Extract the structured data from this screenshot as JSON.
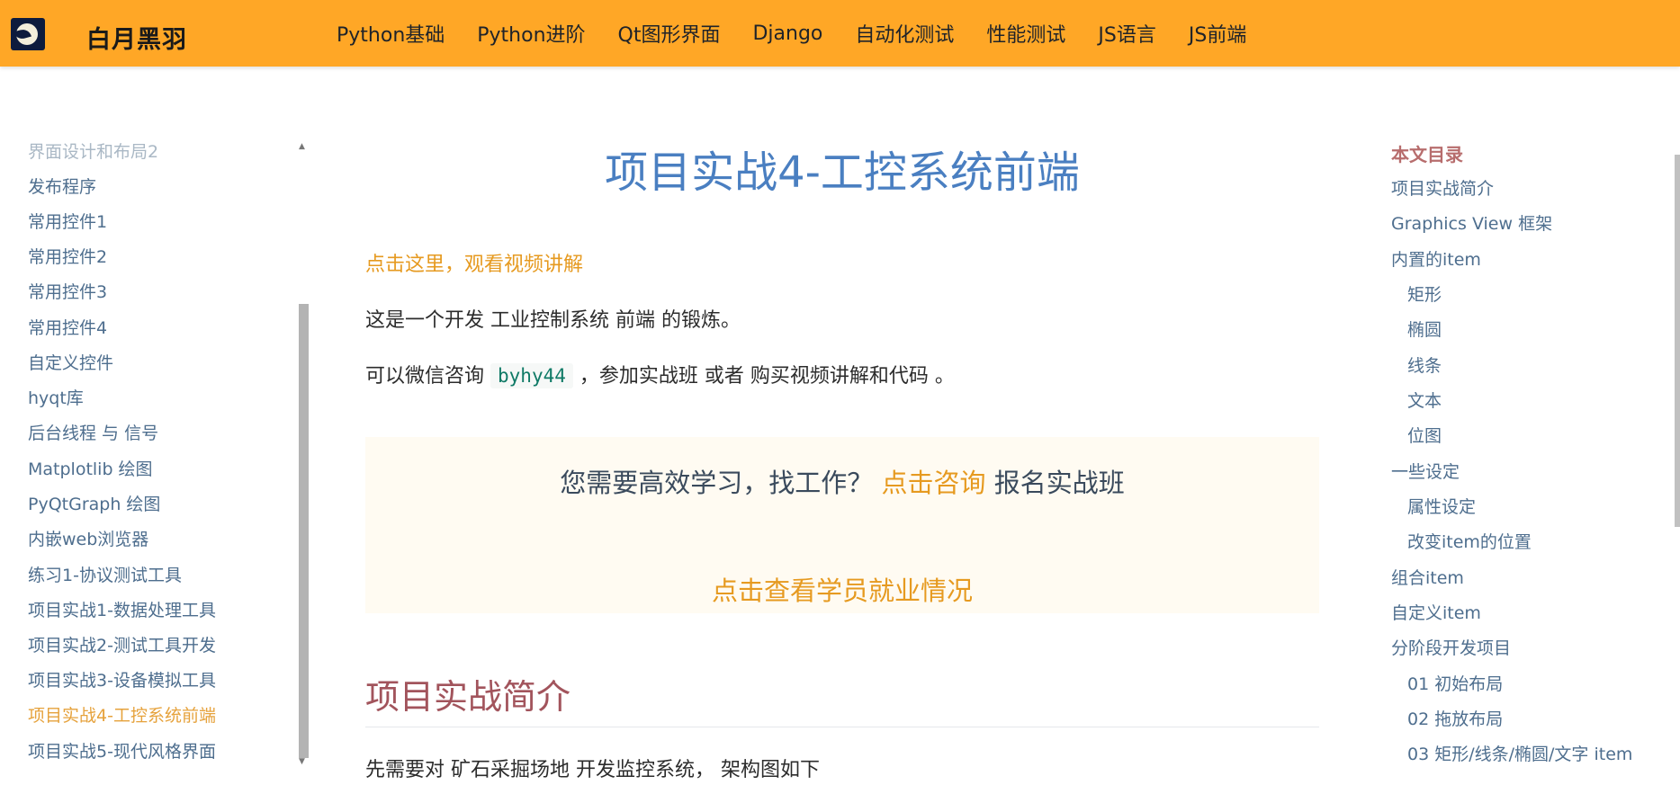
{
  "header": {
    "site_title": "白月黑羽",
    "nav": [
      "Python基础",
      "Python进阶",
      "Qt图形界面",
      "Django",
      "自动化测试",
      "性能测试",
      "JS语言",
      "JS前端"
    ]
  },
  "sidebar": {
    "items": [
      {
        "label": "界面设计和布局2",
        "state": "faded"
      },
      {
        "label": "发布程序",
        "state": "normal"
      },
      {
        "label": "常用控件1",
        "state": "normal"
      },
      {
        "label": "常用控件2",
        "state": "normal"
      },
      {
        "label": "常用控件3",
        "state": "normal"
      },
      {
        "label": "常用控件4",
        "state": "normal"
      },
      {
        "label": "自定义控件",
        "state": "normal"
      },
      {
        "label": "hyqt库",
        "state": "normal"
      },
      {
        "label": "后台线程 与 信号",
        "state": "normal"
      },
      {
        "label": "Matplotlib 绘图",
        "state": "normal"
      },
      {
        "label": "PyQtGraph 绘图",
        "state": "normal"
      },
      {
        "label": "内嵌web浏览器",
        "state": "normal"
      },
      {
        "label": "练习1-协议测试工具",
        "state": "normal"
      },
      {
        "label": "项目实战1-数据处理工具",
        "state": "normal"
      },
      {
        "label": "项目实战2-测试工具开发",
        "state": "normal"
      },
      {
        "label": "项目实战3-设备模拟工具",
        "state": "normal"
      },
      {
        "label": "项目实战4-工控系统前端",
        "state": "active"
      },
      {
        "label": "项目实战5-现代风格界面",
        "state": "normal"
      }
    ]
  },
  "main": {
    "title": "项目实战4-工控系统前端",
    "video_link": "点击这里，观看视频讲解",
    "para1": "这是一个开发 工业控制系统 前端 的锻炼。",
    "para2_before": "可以微信咨询",
    "para2_code": "byhy44",
    "para2_after": "，参加实战班 或者 购买视频讲解和代码 。",
    "promo": {
      "line1_before": "您需要高效学习，找工作？",
      "line1_link": "点击咨询",
      "line1_after": "报名实战班",
      "line2": "点击查看学员就业情况"
    },
    "section_heading": "项目实战简介",
    "para3": "先需要对 矿石采掘场地 开发监控系统， 架构图如下"
  },
  "toc": {
    "title": "本文目录",
    "items": [
      {
        "label": "项目实战简介",
        "level": 1
      },
      {
        "label": "Graphics View 框架",
        "level": 1
      },
      {
        "label": "内置的item",
        "level": 1
      },
      {
        "label": "矩形",
        "level": 2
      },
      {
        "label": "椭圆",
        "level": 2
      },
      {
        "label": "线条",
        "level": 2
      },
      {
        "label": "文本",
        "level": 2
      },
      {
        "label": "位图",
        "level": 2
      },
      {
        "label": "一些设定",
        "level": 1
      },
      {
        "label": "属性设定",
        "level": 2
      },
      {
        "label": "改变item的位置",
        "level": 2
      },
      {
        "label": "组合item",
        "level": 1
      },
      {
        "label": "自定义item",
        "level": 1
      },
      {
        "label": "分阶段开发项目",
        "level": 1
      },
      {
        "label": "01 初始布局",
        "level": 2
      },
      {
        "label": "02 拖放布局",
        "level": 2
      },
      {
        "label": "03 矩形/线条/椭圆/文字 item",
        "level": 2
      }
    ]
  },
  "colors": {
    "header_bg": "#ffa726",
    "accent": "#e69a20",
    "title_blue": "#4a7fc1",
    "heading_red": "#a2545c"
  }
}
